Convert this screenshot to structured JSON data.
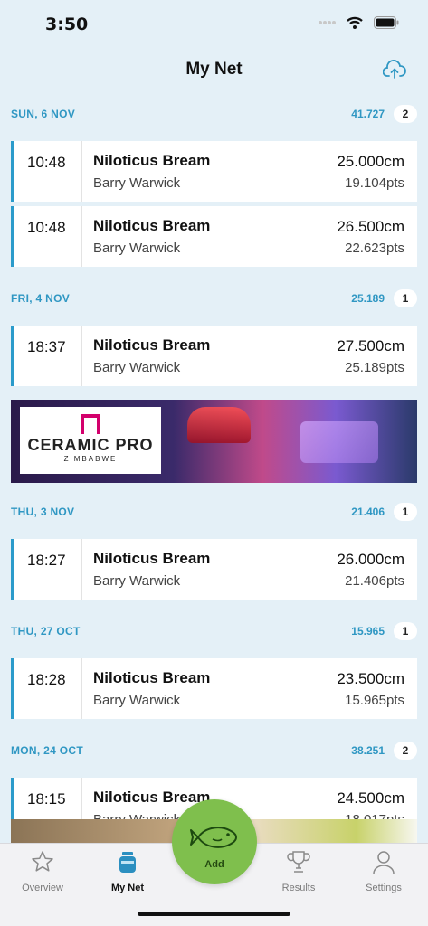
{
  "status": {
    "time": "3:50"
  },
  "nav": {
    "title": "My Net"
  },
  "days": [
    {
      "date": "SUN, 6 NOV",
      "total": "41.727",
      "count": "2",
      "catches": [
        {
          "time": "10:48",
          "species": "Niloticus Bream",
          "angler": "Barry Warwick",
          "length": "25.000cm",
          "points": "19.104pts"
        },
        {
          "time": "10:48",
          "species": "Niloticus Bream",
          "angler": "Barry Warwick",
          "length": "26.500cm",
          "points": "22.623pts"
        }
      ]
    },
    {
      "date": "FRI, 4 NOV",
      "total": "25.189",
      "count": "1",
      "catches": [
        {
          "time": "18:37",
          "species": "Niloticus Bream",
          "angler": "Barry Warwick",
          "length": "27.500cm",
          "points": "25.189pts"
        }
      ]
    },
    {
      "date": "THU, 3 NOV",
      "total": "21.406",
      "count": "1",
      "catches": [
        {
          "time": "18:27",
          "species": "Niloticus Bream",
          "angler": "Barry Warwick",
          "length": "26.000cm",
          "points": "21.406pts"
        }
      ]
    },
    {
      "date": "THU, 27 OCT",
      "total": "15.965",
      "count": "1",
      "catches": [
        {
          "time": "18:28",
          "species": "Niloticus Bream",
          "angler": "Barry Warwick",
          "length": "23.500cm",
          "points": "15.965pts"
        }
      ]
    },
    {
      "date": "MON, 24 OCT",
      "total": "38.251",
      "count": "2",
      "catches": [
        {
          "time": "18:15",
          "species": "Niloticus Bream",
          "angler": "Barry Warwick",
          "length": "24.500cm",
          "points": "18.017pts"
        }
      ]
    }
  ],
  "ad": {
    "brand": "CERAMIC PRO",
    "sub": "ZIMBABWE"
  },
  "tabs": {
    "overview": "Overview",
    "mynet": "My Net",
    "add": "Add",
    "results": "Results",
    "settings": "Settings"
  },
  "colors": {
    "accent": "#2f97c3",
    "add": "#7fbf4d",
    "background": "#e4f0f7"
  },
  "icons": {
    "upload": "cloud-upload-icon",
    "overview": "star-icon",
    "mynet": "jar-icon",
    "add": "fish-icon",
    "results": "trophy-icon",
    "settings": "person-icon"
  }
}
